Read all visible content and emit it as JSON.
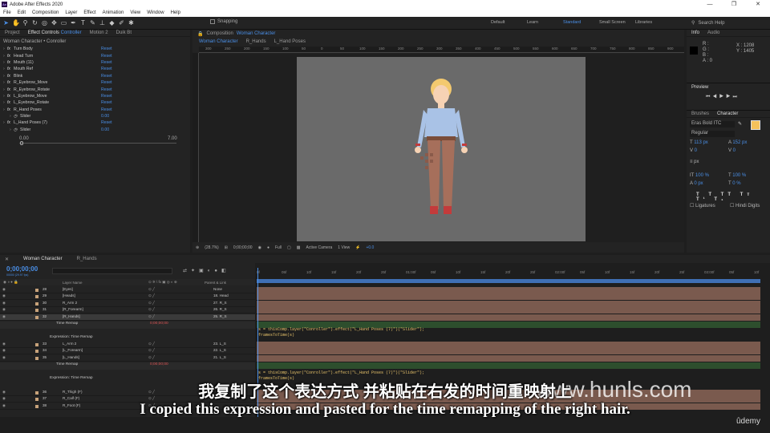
{
  "window": {
    "title": "Adobe After Effects 2020",
    "controls": [
      "—",
      "❐",
      "✕"
    ]
  },
  "menu": [
    "File",
    "Edit",
    "Composition",
    "Layer",
    "Effect",
    "Animation",
    "View",
    "Window",
    "Help"
  ],
  "toolbar": {
    "snapping": "Snapping",
    "workspaces": [
      "Default",
      "Learn",
      "Standard",
      "Small Screen",
      "Libraries"
    ],
    "active_workspace": "Standard",
    "search_placeholder": "Search Help"
  },
  "left_panel": {
    "tabs": [
      "Project",
      "Effect Controls",
      "Controller",
      "Motion 2",
      "Duik Bt"
    ],
    "breadcrumb": "Woman Character • Conroller",
    "effects": [
      {
        "label": "Turn Body",
        "reset": "Reset"
      },
      {
        "label": "Head Turn",
        "reset": "Reset"
      },
      {
        "label": "Mouth (11)",
        "reset": "Reset"
      },
      {
        "label": "Mouth Ref",
        "reset": "Reset"
      },
      {
        "label": "Blink",
        "reset": "Reset"
      },
      {
        "label": "R_Eyebrow_Move",
        "reset": "Reset"
      },
      {
        "label": "R_Eyebrow_Rotate",
        "reset": "Reset"
      },
      {
        "label": "L_Eyebrow_Move",
        "reset": "Reset"
      },
      {
        "label": "L_Eyebrow_Rotate",
        "reset": "Reset"
      },
      {
        "label": "R_Hand Poses",
        "reset": "Reset"
      },
      {
        "label": "Slider",
        "value": "0.00",
        "sub": true
      },
      {
        "label": "L_Hand Poses (7)",
        "reset": "Reset"
      },
      {
        "label": "Slider",
        "value": "0.00",
        "sub": true
      }
    ],
    "slider_min": "0.00",
    "slider_max": "7.00"
  },
  "viewer": {
    "tab_label": "Composition",
    "tab_comp": "Woman Character",
    "flow": [
      "Woman Character",
      "R_Hands",
      "L_Hand Poses"
    ],
    "ruler": [
      "300",
      "250",
      "200",
      "150",
      "100",
      "50",
      "0",
      "50",
      "100",
      "150",
      "200",
      "250",
      "300",
      "350",
      "400",
      "450",
      "500",
      "550",
      "600",
      "650",
      "700",
      "750",
      "800",
      "850",
      "900",
      "950"
    ],
    "bottom": {
      "zoom": "(28.7%)",
      "time": "0;00;00;00",
      "resolution": "Full",
      "camera": "Active Camera",
      "views": "1 View",
      "exposure": "+0.0"
    }
  },
  "right_panel": {
    "info_tabs": [
      "Info",
      "Audio"
    ],
    "info": {
      "R": "R :",
      "G": "G :",
      "B": "B :",
      "A": "A : 0",
      "X": "X : 1208",
      "Y": "Y : 1405"
    },
    "preview_label": "Preview",
    "char_tabs": [
      "Brushes",
      "Character"
    ],
    "font": "Eras Bold ITC",
    "style": "Regular",
    "size": "113 px",
    "leading": "152 px",
    "tracking": "0",
    "kerning": "0",
    "stroke": "px",
    "vscale": "100 %",
    "hscale": "100 %",
    "baseline": "0 px",
    "tsume": "0 %",
    "ligatures": "Ligatures",
    "hindi": "Hindi Digits",
    "fill_color": "#f4c15b"
  },
  "timeline": {
    "tabs": [
      "Woman Character",
      "R_Hands"
    ],
    "timecode": "0;00;00;00",
    "fps": "00000 (29.97 fps)",
    "headers": {
      "layer": "Layer Name",
      "parent": "Parent & Link"
    },
    "ruler": [
      "0f",
      "05f",
      "10f",
      "15f",
      "20f",
      "25f",
      "01:00f",
      "05f",
      "10f",
      "15f",
      "20f",
      "25f",
      "02:00f",
      "05f",
      "10f",
      "15f",
      "20f",
      "25f",
      "03:00f",
      "05f",
      "10f"
    ],
    "layers": [
      {
        "num": "28",
        "name": "[Eyes]",
        "parent": "None",
        "color": "#c7a27a"
      },
      {
        "num": "29",
        "name": "[Heads]",
        "parent": "18. Head",
        "color": "#c7a27a"
      },
      {
        "num": "30",
        "name": "R_Arm 2",
        "parent": "27. R_S",
        "color": "#c7a27a"
      },
      {
        "num": "31",
        "name": "[R_Forearm]",
        "parent": "26. R_S",
        "color": "#c7a27a"
      },
      {
        "num": "32",
        "name": "[R_Hands]",
        "parent": "25. R_S",
        "color": "#c7a27a",
        "selected": true
      },
      {
        "num": "33",
        "name": "L_Arm 2",
        "parent": "23. L_S",
        "color": "#c7a27a"
      },
      {
        "num": "34",
        "name": "[L_Forearm]",
        "parent": "22. L_S",
        "color": "#c7a27a"
      },
      {
        "num": "35",
        "name": "[L_Hands]",
        "parent": "21. L_S",
        "color": "#c7a27a"
      },
      {
        "num": "36",
        "name": "R_Thigh (F)",
        "parent": "",
        "color": "#c7a27a"
      },
      {
        "num": "37",
        "name": "R_Calf (F)",
        "parent": "",
        "color": "#c7a27a"
      },
      {
        "num": "38",
        "name": "R_Foot (F)",
        "parent": "",
        "color": "#c7a27a"
      }
    ],
    "time_remap": "Time Remap",
    "remap_value": "0;00;00;00",
    "expression_label": "Expression: Time Remap",
    "expr1_line1": "s = thisComp.layer(\"Conroller\").effect(\"L_Hand Poses (7)\")(\"Slider\");",
    "expr1_line2": "framesToTime(s)",
    "expr2_line1": "s = thisComp.layer(\"Conroller\").effect(\"L_Hand Poses (7)\")(\"Slider\");",
    "expr2_line2": "framesToTime(s)"
  },
  "subtitles": {
    "cn": "我复制了这个表达方式 并粘贴在右发的时间重映射上",
    "en": "I copied this expression and pasted for the time remapping of the right hair."
  },
  "watermark": "www.hunls.com",
  "brand": "ûdemy"
}
